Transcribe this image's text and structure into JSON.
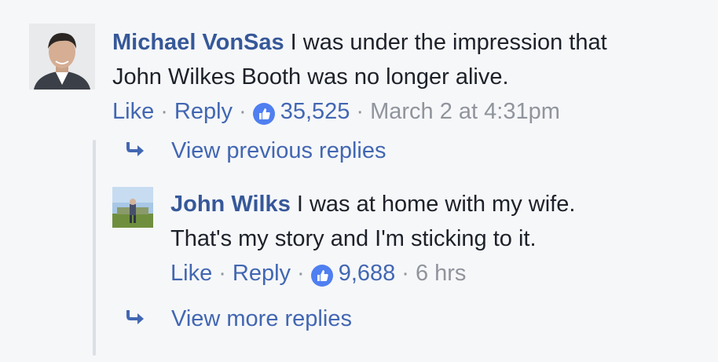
{
  "colors": {
    "background": "#f6f7f9",
    "author": "#365899",
    "link": "#4267b2",
    "muted": "#90949c",
    "text": "#1d2129",
    "thread_line": "#dcdfe4"
  },
  "comments": [
    {
      "author": "Michael VonSas",
      "text_line1": "I was under the impression that",
      "text_line2": "John Wilkes Booth was no longer alive.",
      "like_label": "Like",
      "reply_label": "Reply",
      "reaction_icon": "thumbs-up-icon",
      "reaction_count": "35,525",
      "timestamp": "March 2 at 4:31pm"
    },
    {
      "author": "John Wilks",
      "text_line1": "I was at home with my wife.",
      "text_line2": "That's my story and I'm sticking to it.",
      "like_label": "Like",
      "reply_label": "Reply",
      "reaction_icon": "thumbs-up-icon",
      "reaction_count": "9,688",
      "timestamp": "6 hrs"
    }
  ],
  "replies": {
    "view_previous": "View previous replies",
    "view_more": "View more replies",
    "arrow_icon": "reply-arrow-icon"
  },
  "separator": "·"
}
